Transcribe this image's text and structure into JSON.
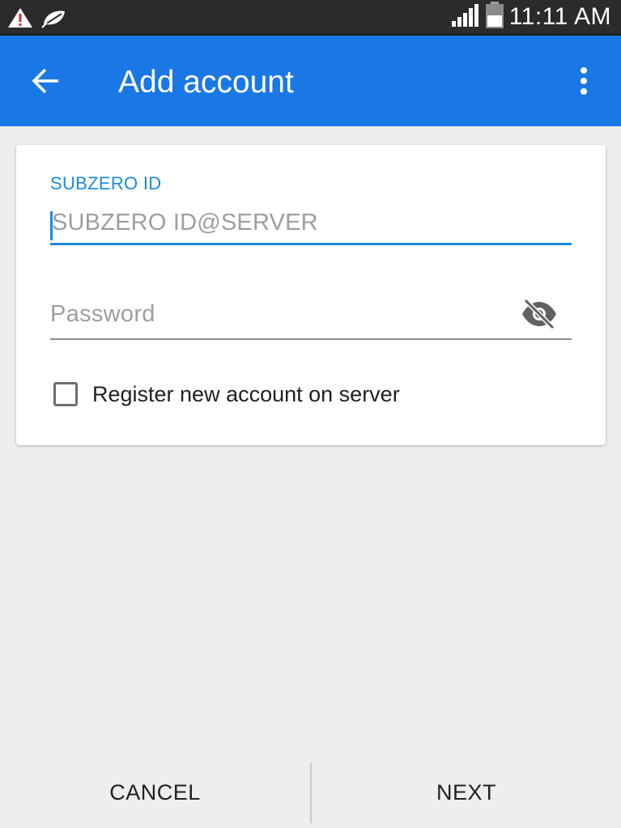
{
  "status_bar": {
    "time": "11:11 AM",
    "icons": [
      "warning-icon",
      "leaf-icon",
      "signal-icon",
      "battery-icon"
    ]
  },
  "app_bar": {
    "title": "Add account",
    "back_icon": "arrow-back-icon",
    "menu_icon": "more-vert-icon",
    "color": "#1a78e6"
  },
  "form": {
    "id_label": "SUBZERO ID",
    "id_placeholder": "SUBZERO ID@SERVER",
    "id_value": "",
    "password_placeholder": "Password",
    "password_value": "",
    "password_toggle_icon": "visibility-off-icon",
    "register_label": "Register new account on server",
    "register_checked": false,
    "accent": "#1b8be0"
  },
  "actions": {
    "cancel_label": "CANCEL",
    "next_label": "NEXT"
  }
}
